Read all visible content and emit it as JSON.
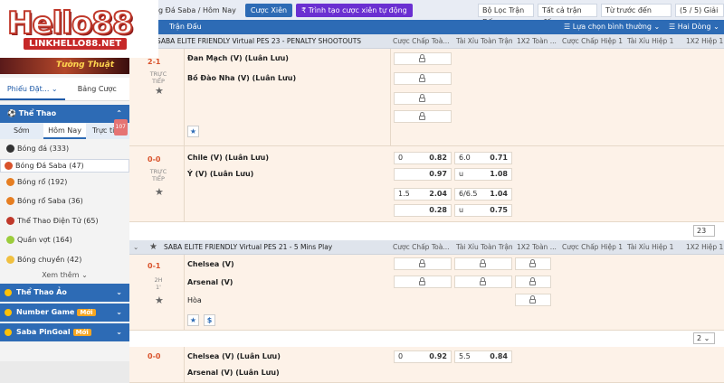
{
  "logo": {
    "brand": "Hello88",
    "url": "LINKHELLO88.NET"
  },
  "sidebar": {
    "banner": "Tường Thuật",
    "tabs": [
      "Phiếu Đặt...",
      "Bảng Cược"
    ],
    "section": "Thể Thao",
    "subtabs": [
      "Sớm",
      "Hôm Nay",
      "Trực tiếp"
    ],
    "live_count": "107",
    "sports": [
      {
        "label": "Bóng đá",
        "count": "(333)",
        "color": "#333"
      },
      {
        "label": "Bóng Đá Saba",
        "count": "(47)",
        "color": "#d9532c"
      },
      {
        "label": "Bóng rổ",
        "count": "(192)",
        "color": "#e67e22"
      },
      {
        "label": "Bóng rổ Saba",
        "count": "(36)",
        "color": "#e67e22"
      },
      {
        "label": "Thể Thao Điện Tử",
        "count": "(65)",
        "color": "#c0392b"
      },
      {
        "label": "Quần vợt",
        "count": "(164)",
        "color": "#9ccc3c"
      },
      {
        "label": "Bóng chuyền",
        "count": "(42)",
        "color": "#f0c040"
      }
    ],
    "more": "Xem thêm",
    "cats": [
      {
        "label": "Thể Thao Ảo",
        "badge": ""
      },
      {
        "label": "Number Game",
        "badge": "Mới"
      },
      {
        "label": "Saba PinGoal",
        "badge": "Mới"
      }
    ]
  },
  "topbar": {
    "breadcrumb": "g Đá Saba / Hôm Nay",
    "btn1": "Cược Xiên",
    "btn2": "₹ Trình tạo cược xiên tự động",
    "filters": [
      "Bộ Lọc Trận Đấu",
      "Tất cả trận đấu",
      "Từ trước đến nay",
      "(5 / 5) Giải"
    ]
  },
  "subheader": {
    "left": "Trận Đấu",
    "sort": "Lựa chọn bình thường",
    "odds": "Hai Dòng"
  },
  "leagues": [
    {
      "name": "SABA ELITE FRIENDLY Virtual PES 23 - PENALTY SHOOTOUTS",
      "cols": [
        "Cược Chấp Toà...",
        "Tài Xỉu Toàn Trận",
        "1X2 Toàn ...",
        "Cược Chấp Hiệp 1",
        "Tài Xỉu Hiệp 1",
        "1X2 Hiệp 1"
      ]
    },
    {
      "name": "SABA ELITE FRIENDLY Virtual PES 21 - 5 Mins Play",
      "cols": [
        "Cược Chấp Toà...",
        "Tài Xỉu Toàn Trận",
        "1X2 Toàn ...",
        "Cược Chấp Hiệp 1",
        "Tài Xỉu Hiệp 1",
        "1X2 Hiệp 1"
      ]
    }
  ],
  "matches": [
    {
      "score": "2-1",
      "status": "TRỰC TIẾP",
      "home": "Đan Mạch (V) (Luân Lưu)",
      "away": "Bồ Đào Nha (V) (Luân Lưu)"
    },
    {
      "score": "0-0",
      "status": "TRỰC TIẾP",
      "home": "Chile (V) (Luân Lưu)",
      "away": "Ý (V) (Luân Lưu)",
      "odds": {
        "r1": {
          "hcap": "0",
          "h": "0.82",
          "ou": "6.0",
          "o": "0.71"
        },
        "r2": {
          "h": "0.97",
          "ou": "u",
          "o": "1.08"
        },
        "r3": {
          "hcap": "1.5",
          "h": "2.04",
          "ou": "6/6.5",
          "o": "1.04"
        },
        "r4": {
          "h": "0.28",
          "ou": "u",
          "o": "0.75"
        }
      },
      "pager": "23"
    },
    {
      "score": "0-1",
      "status": "2H",
      "minute": "1'",
      "home": "Chelsea (V)",
      "away": "Arsenal (V)",
      "draw": "Hòa",
      "pager": "2"
    },
    {
      "score": "0-0",
      "home": "Chelsea (V) (Luân Lưu)",
      "away": "Arsenal (V) (Luân Lưu)",
      "odds": {
        "hcap": "0",
        "h": "0.92",
        "ou": "5.5",
        "o": "0.84"
      }
    }
  ]
}
